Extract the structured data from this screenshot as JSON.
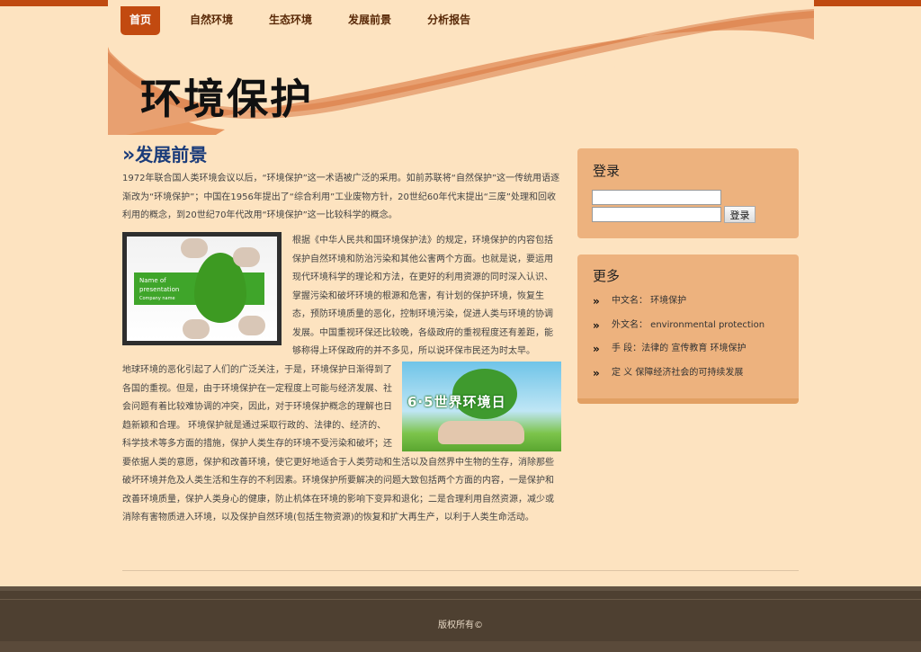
{
  "nav": {
    "items": [
      {
        "label": "首页",
        "active": true
      },
      {
        "label": "自然环境"
      },
      {
        "label": "生态环境"
      },
      {
        "label": "发展前景"
      },
      {
        "label": "分析报告"
      }
    ]
  },
  "header": {
    "logo_text": "环境保护"
  },
  "main": {
    "section_title": "发展前景",
    "paragraph1": "1972年联合国人类环境会议以后，“环境保护”这一术语被广泛的采用。如前苏联将“自然保护”这一传统用语逐渐改为“环境保护”；中国在1956年提出了“综合利用”工业废物方针，20世纪60年代末提出“三废”处理和回收利用的概念，到20世纪70年代改用“环境保护”这一比较科学的概念。",
    "image1": {
      "caption_line1": "Name of",
      "caption_line2": "presentation",
      "caption_line3": "Company name"
    },
    "paragraph2": "根据《中华人民共和国环境保护法》的规定，环境保护的内容包括保护自然环境和防治污染和其他公害两个方面。也就是说，要运用现代环境科学的理论和方法，在更好的利用资源的同时深入认识、掌握污染和破坏环境的根源和危害，有计划的保护环境，恢复生态，预防环境质量的恶化，控制环境污染，促进人类与环境的协调发展。中国重视环保还比较晚，各级政府的重视程度还有差距，能够称得上环保政府的并不多见，所以说环保市民还为时太早。",
    "image2": {
      "caption": "6·5世界环境日"
    },
    "paragraph3": "地球环境的恶化引起了人们的广泛关注，于是，环境保护日渐得到了各国的重视。但是，由于环境保护在一定程度上可能与经济发展、社会问题有着比较难协调的冲突，因此，对于环境保护概念的理解也日趋新颖和合理。 环境保护就是通过采取行政的、法律的、经济的、科学技术等多方面的措施，保护人类生存的环境不受污染和破坏；还要依据人类的意愿，保护和改善环境，使它更好地适合于人类劳动和生活以及自然界中生物的生存，消除那些破坏环境并危及人类生活和生存的不利因素。环境保护所要解决的问题大致包括两个方面的内容，一是保护和改善环境质量，保护人类身心的健康，防止机体在环境的影响下变异和退化；二是合理利用自然资源，减少或消除有害物质进入环境，以及保护自然环境(包括生物资源)的恢复和扩大再生产，以利于人类生命活动。"
  },
  "sidebar": {
    "login": {
      "title": "登录",
      "username_value": "",
      "password_value": "",
      "button_label": "登录"
    },
    "more": {
      "title": "更多",
      "items": [
        {
          "label": "中文名： 环境保护"
        },
        {
          "label": "外文名： environmental protection"
        },
        {
          "label": "手 段：法律的 宣传教育 环境保护"
        },
        {
          "label": "定 义 保障经济社会的可持续发展"
        }
      ]
    }
  },
  "footer": {
    "text": "版权所有©"
  },
  "colors": {
    "accent": "#c24a10",
    "title_blue": "#1b3c7a",
    "sidebar_bg": "#edb27e",
    "footer_bg": "#4e4031"
  }
}
